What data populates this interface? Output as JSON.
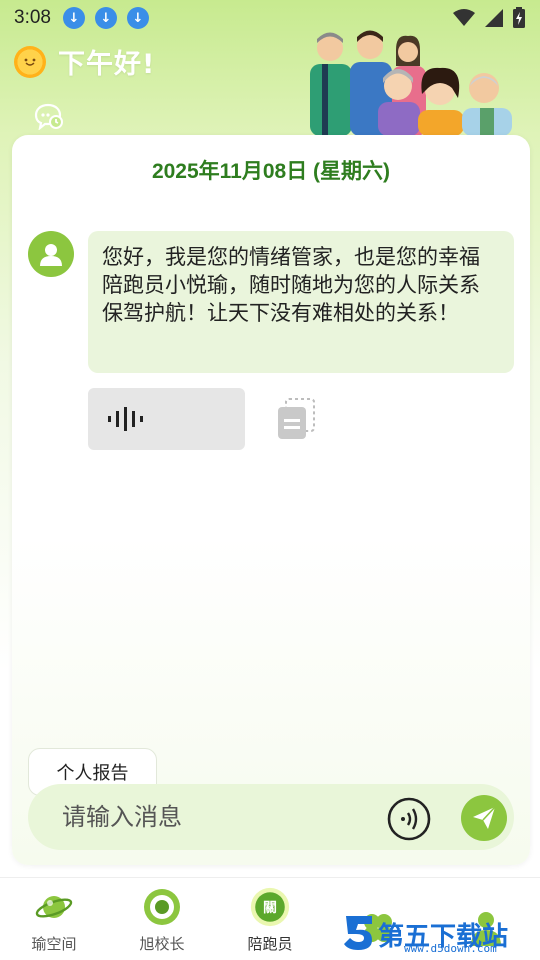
{
  "status_bar": {
    "time": "3:08"
  },
  "header": {
    "greeting": "下午好!"
  },
  "chat": {
    "date": "2025年11月08日 (星期六)",
    "messages": [
      {
        "sender": "assistant",
        "text": "您好，我是您的情绪管家，也是您的幸福陪跑员小悦瑜，随时随地为您的人际关系保驾护航！让天下没有难相处的关系！"
      }
    ]
  },
  "report_chip": {
    "label": "个人报告"
  },
  "input": {
    "placeholder": "请输入消息"
  },
  "tabs": [
    {
      "label": "瑜空间",
      "icon": "planet-icon",
      "active": false
    },
    {
      "label": "旭校长",
      "icon": "target-icon",
      "active": false
    },
    {
      "label": "陪跑员",
      "icon": "badge-icon",
      "active": true
    },
    {
      "label": "",
      "icon": "clover-icon",
      "active": false
    },
    {
      "label": "",
      "icon": "person-icon",
      "active": false
    }
  ],
  "watermark": {
    "text": "第五下载站",
    "sub": "www.d5down.com"
  },
  "colors": {
    "accent": "#8cc63f",
    "date_green": "#2e7d1f",
    "bubble": "#eaf5dc",
    "input_bg": "#e9f6d9"
  }
}
